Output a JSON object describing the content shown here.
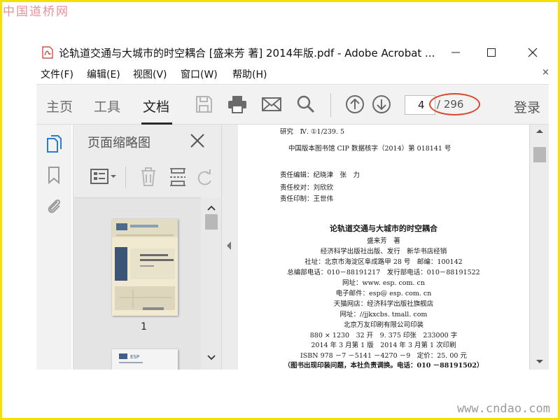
{
  "watermark": {
    "top": "中国道桥网",
    "bottom": "www.cndao.com"
  },
  "window": {
    "title": "论轨道交通与大城市的时空耦合 [盛来芳 著] 2014年版.pdf - Adobe Acrobat ..."
  },
  "menu": {
    "items": [
      "文件(F)",
      "编辑(E)",
      "视图(V)",
      "窗口(W)",
      "帮助(H)"
    ],
    "close": "×"
  },
  "toolbar": {
    "tabs": [
      "主页",
      "工具",
      "文档"
    ],
    "active_tab": "文档",
    "page_current": "4",
    "page_total": "/ 296",
    "login": "登录"
  },
  "thumbnails": {
    "header": "页面缩略图",
    "pages": [
      {
        "label": "1",
        "cover_title": "论轨道交通与大城市的时空耦合"
      },
      {
        "label": "",
        "logo": "ESP"
      }
    ]
  },
  "document": {
    "lines": [
      "研究　Ⅳ. ①1/239. 5",
      "中国版本图书馆 CIP 数据核字（2014）第 018141 号",
      "责任编辑：纪晓津　张　力",
      "责任校对：刘欣欣",
      "责任印制：王世伟",
      "论轨道交通与大城市的时空耦合",
      "盛来芳　著",
      "经济科学出版社出版、发行　新华书店经销",
      "社址：北京市海淀区阜成路甲 28 号　邮编：100142",
      "总编部电话：010－88191217　发行部电话：010－88191522",
      "网址：www. esp. com. cn",
      "电子邮件：esp@ esp. com. cn",
      "天猫网店：经济科学出版社旗舰店",
      "网址：//jjkxcbs. tmall. com",
      "北京万友印刷有限公司印装",
      "880 × 1230　32 开　9. 375 印张　233000 字",
      "2014 年 3 月第 1 版　2014 年 3 月第 1 次印刷",
      "ISBN 978 －7 －5141 －4270 －9　定价：25. 00 元",
      "（图书出现印装问题，本社负责调换。电话：010 －88191502）"
    ]
  },
  "colors": {
    "frame": "#f5e000",
    "annotation_oval": "#d9472a",
    "toolbar_bg": "#f2f2f2"
  }
}
